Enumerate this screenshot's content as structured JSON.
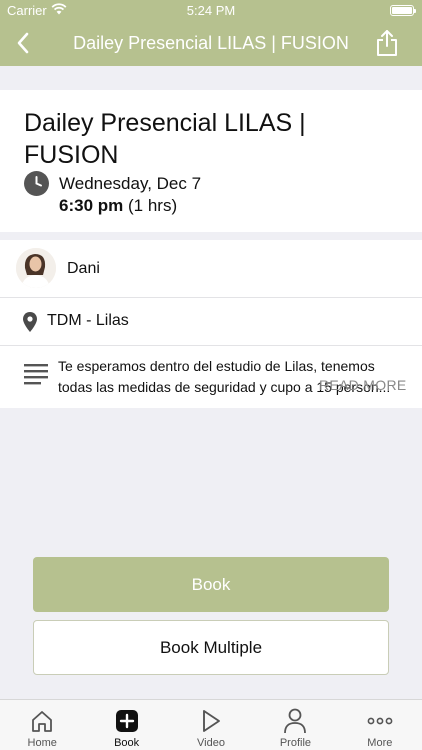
{
  "status_bar": {
    "carrier": "Carrier",
    "time": "5:24 PM"
  },
  "nav": {
    "title": "Dailey Presencial LILAS | FUSION"
  },
  "event": {
    "title": "Dailey Presencial LILAS | FUSION",
    "date": "Wednesday, Dec 7",
    "time": "6:30 pm",
    "duration": "(1 hrs)"
  },
  "instructor": {
    "name": "Dani"
  },
  "location": {
    "name": "TDM - Lilas"
  },
  "description": {
    "text": "Te esperamos dentro del estudio de Lilas, tenemos todas las medidas de seguridad y cupo a 15 person...",
    "read_more": "READ MORE"
  },
  "buttons": {
    "book": "Book",
    "book_multiple": "Book Multiple"
  },
  "tabs": [
    {
      "label": "Home",
      "icon": "home-icon"
    },
    {
      "label": "Book",
      "icon": "plus-square-icon"
    },
    {
      "label": "Video",
      "icon": "play-icon"
    },
    {
      "label": "Profile",
      "icon": "person-icon"
    },
    {
      "label": "More",
      "icon": "ellipsis-icon"
    }
  ],
  "colors": {
    "accent": "#b6c18f",
    "background": "#efeff4"
  }
}
